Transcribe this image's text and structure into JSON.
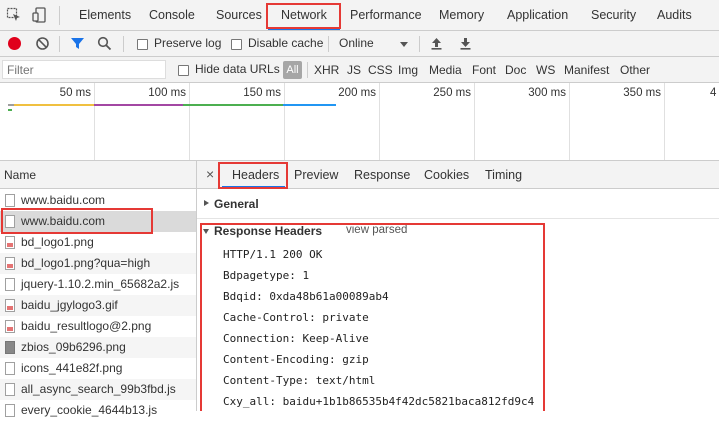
{
  "top_tabs": [
    "Elements",
    "Console",
    "Sources",
    "Network",
    "Performance",
    "Memory",
    "Application",
    "Security",
    "Audits"
  ],
  "toolbar": {
    "preserve_log": "Preserve log",
    "disable_cache": "Disable cache",
    "throttle": "Online"
  },
  "filterbar": {
    "filter_placeholder": "Filter",
    "hide_data_urls": "Hide data URLs",
    "types": [
      "All",
      "XHR",
      "JS",
      "CSS",
      "Img",
      "Media",
      "Font",
      "Doc",
      "WS",
      "Manifest",
      "Other"
    ]
  },
  "timeline": {
    "ticks": [
      "50 ms",
      "100 ms",
      "150 ms",
      "200 ms",
      "250 ms",
      "300 ms",
      "350 ms",
      "4"
    ]
  },
  "name_column": {
    "header": "Name",
    "rows": [
      "www.baidu.com",
      "www.baidu.com",
      "bd_logo1.png",
      "bd_logo1.png?qua=high",
      "jquery-1.10.2.min_65682a2.js",
      "baidu_jgylogo3.gif",
      "baidu_resultlogo@2.png",
      "zbios_09b6296.png",
      "icons_441e82f.png",
      "all_async_search_99b3fbd.js",
      "every_cookie_4644b13.js"
    ]
  },
  "details": {
    "close": "×",
    "tabs": [
      "Headers",
      "Preview",
      "Response",
      "Cookies",
      "Timing"
    ],
    "general": "General",
    "response_headers": "Response Headers",
    "view_parsed": "view parsed",
    "header_lines": [
      "HTTP/1.1 200 OK",
      "Bdpagetype: 1",
      "Bdqid: 0xda48b61a00089ab4",
      "Cache-Control: private",
      "Connection: Keep-Alive",
      "Content-Encoding: gzip",
      "Content-Type: text/html",
      "Cxy_all: baidu+1b1b86535b4f42dc5821baca812fd9c4"
    ]
  },
  "colors": {
    "accent": "#1a73e8",
    "highlight": "#e53935",
    "record": "#e0001b"
  }
}
